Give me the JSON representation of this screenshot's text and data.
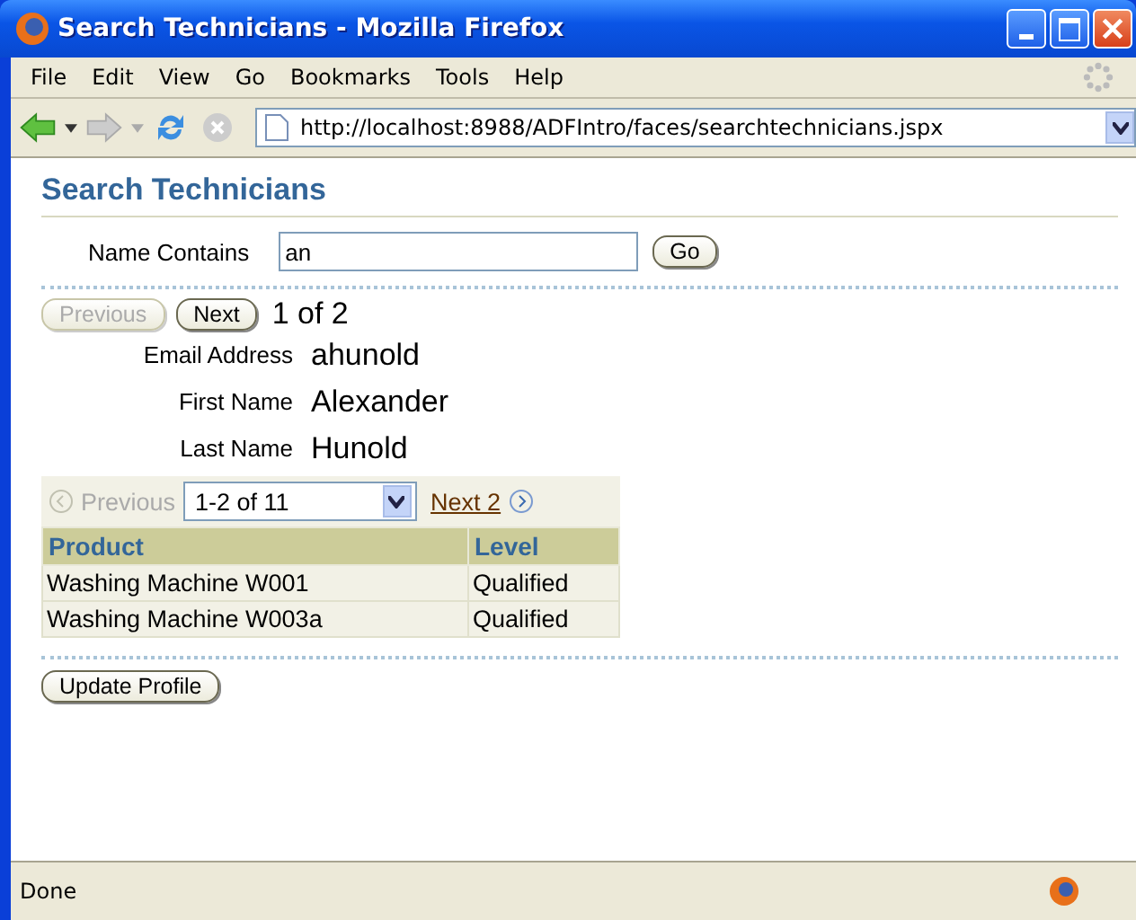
{
  "window": {
    "title": "Search Technicians - Mozilla Firefox"
  },
  "menu": [
    "File",
    "Edit",
    "View",
    "Go",
    "Bookmarks",
    "Tools",
    "Help"
  ],
  "address": {
    "value": "http://localhost:8988/ADFIntro/faces/searchtechnicians.jspx"
  },
  "page_title": "Search Technicians",
  "search": {
    "label": "Name Contains",
    "value": "an",
    "button": "Go"
  },
  "record_nav": {
    "previous": {
      "label": "Previous",
      "disabled": true
    },
    "next": {
      "label": "Next",
      "disabled": false
    },
    "position": "1 of 2"
  },
  "fields": [
    {
      "label": "Email Address",
      "value": "ahunold"
    },
    {
      "label": "First Name",
      "value": "Alexander"
    },
    {
      "label": "Last Name",
      "value": "Hunold"
    }
  ],
  "table_nav": {
    "previous": "Previous",
    "range": "1-2 of 11",
    "next": "Next 2"
  },
  "table": {
    "columns": [
      "Product",
      "Level"
    ],
    "rows": [
      [
        "Washing Machine W001",
        "Qualified"
      ],
      [
        "Washing Machine W003a",
        "Qualified"
      ]
    ]
  },
  "update_button": "Update Profile",
  "status_bar": "Done"
}
